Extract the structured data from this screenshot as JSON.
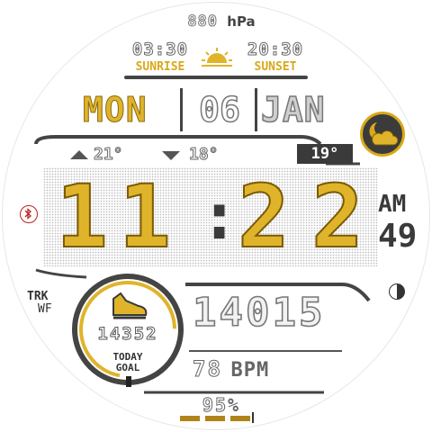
{
  "pressure": {
    "value": "880",
    "unit": "hPa"
  },
  "sun": {
    "sunrise_time": "03:30",
    "sunset_time": "20:30",
    "sunrise_label": "SUNRISE",
    "sunset_label": "SUNSET",
    "icon": "sunrise-icon"
  },
  "date": {
    "day": "MON",
    "date": "06",
    "month": "JAN"
  },
  "weather": {
    "high": "21°",
    "low": "18°",
    "current": "19°",
    "icon": "partly-cloudy-night-icon"
  },
  "time": {
    "h1": "1",
    "h2": "1",
    "m1": "2",
    "m2": "2",
    "separator": ":",
    "ampm": "AM",
    "seconds": "49"
  },
  "bluetooth": {
    "icon": "bluetooth-icon"
  },
  "tracker": {
    "line1": "TRK",
    "line2": "WF"
  },
  "steps": {
    "count": "14352",
    "goal_label_1": "TODAY",
    "goal_label_2": "GOAL",
    "total": "14015",
    "icon": "shoe-icon",
    "goal_progress": 0.72
  },
  "heart": {
    "value": "78",
    "unit": "BPM"
  },
  "battery": {
    "value": "95",
    "unit": "%",
    "level": 0.95
  },
  "moon": {
    "icon": "moon-phase-icon"
  },
  "colors": {
    "accent": "#d9a81a",
    "dark": "#3a3a3a",
    "outline": "#6a6a6a"
  }
}
